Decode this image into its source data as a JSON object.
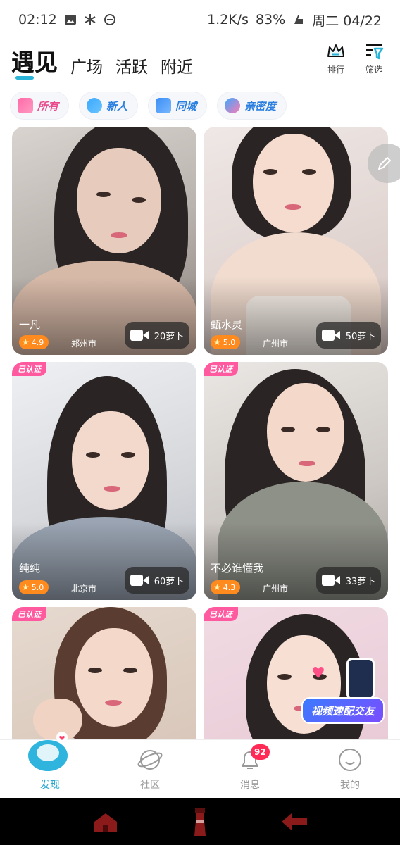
{
  "status_bar": {
    "time": "02:12",
    "net_speed": "1.2K/s",
    "battery": "83%",
    "date": "周二 04/22"
  },
  "header": {
    "tabs": [
      {
        "label": "遇见",
        "active": true
      },
      {
        "label": "广场",
        "active": false
      },
      {
        "label": "活跃",
        "active": false
      },
      {
        "label": "附近",
        "active": false
      }
    ],
    "rank_label": "排行",
    "filter_label": "筛选",
    "accent_color": "#2bb3d8"
  },
  "chips": [
    {
      "label": "所有",
      "icon": "grid-icon"
    },
    {
      "label": "新人",
      "icon": "new-person-icon"
    },
    {
      "label": "同城",
      "icon": "city-icon"
    },
    {
      "label": "亲密度",
      "icon": "heart-icon"
    }
  ],
  "cards": [
    {
      "name": "一凡",
      "rating": "4.9",
      "city": "郑州市",
      "price": "20萝卜",
      "verified": true
    },
    {
      "name": "甄水灵",
      "rating": "5.0",
      "city": "广州市",
      "price": "50萝卜",
      "verified": true
    },
    {
      "name": "纯纯",
      "rating": "5.0",
      "city": "北京市",
      "price": "60萝卜",
      "verified": true,
      "badge": "已认证"
    },
    {
      "name": "不必谁懂我",
      "rating": "4.3",
      "city": "广州市",
      "price": "33萝卜",
      "verified": true,
      "badge": "已认证"
    },
    {
      "name": "",
      "verified": true,
      "badge": "已认证"
    },
    {
      "name": "",
      "verified": true,
      "badge": "已认证"
    }
  ],
  "promo": {
    "label": "视频速配交友"
  },
  "bottom_nav": [
    {
      "label": "发现",
      "active": true
    },
    {
      "label": "社区",
      "active": false
    },
    {
      "label": "消息",
      "active": false,
      "badge": "92"
    },
    {
      "label": "我的",
      "active": false
    }
  ]
}
